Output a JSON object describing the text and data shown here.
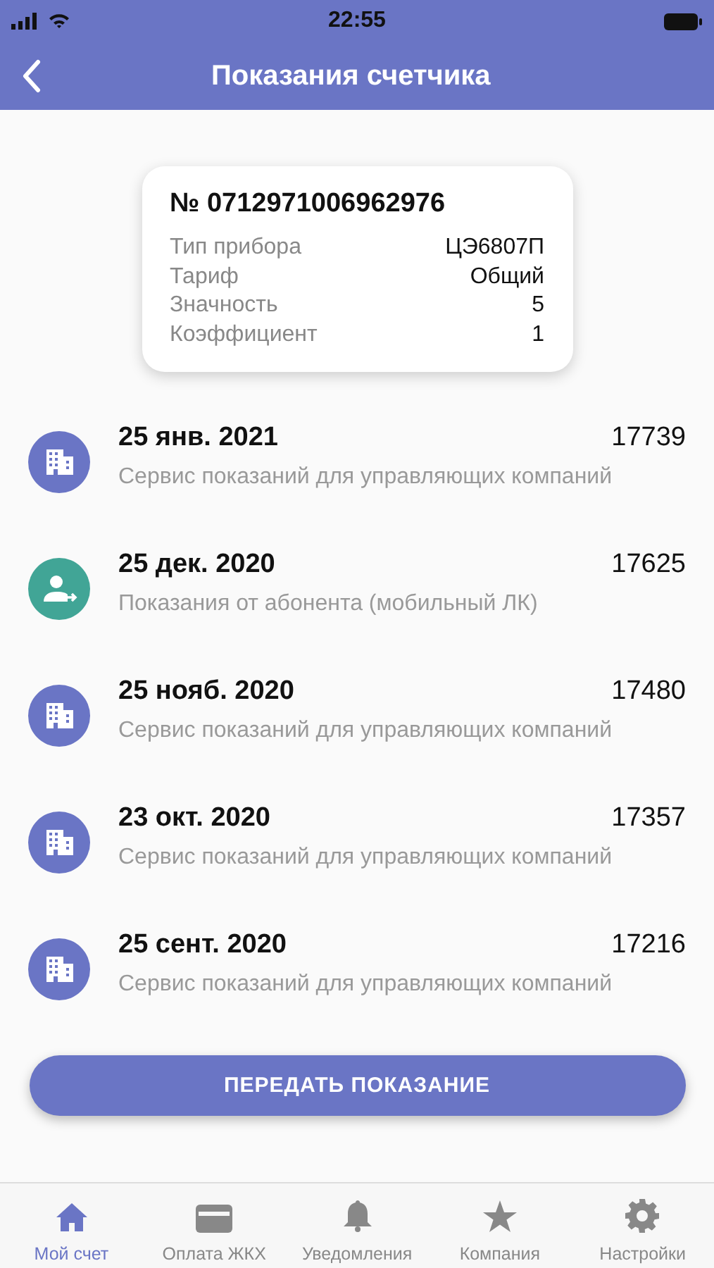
{
  "status_bar": {
    "time": "22:55"
  },
  "header": {
    "title": "Показания счетчика"
  },
  "meter": {
    "number": "№ 0712971006962976",
    "props": [
      {
        "label": "Тип прибора",
        "value": "ЦЭ6807П"
      },
      {
        "label": "Тариф",
        "value": "Общий"
      },
      {
        "label": "Значность",
        "value": "5"
      },
      {
        "label": "Коэффициент",
        "value": "1"
      }
    ]
  },
  "readings": [
    {
      "kind": "company",
      "date": "25 янв. 2021",
      "value": "17739",
      "source": "Сервис показаний для управляющих компаний"
    },
    {
      "kind": "subscriber",
      "date": "25 дек. 2020",
      "value": "17625",
      "source": "Показания от абонента (мобильный ЛК)"
    },
    {
      "kind": "company",
      "date": "25 нояб. 2020",
      "value": "17480",
      "source": "Сервис показаний для управляющих компаний"
    },
    {
      "kind": "company",
      "date": "23 окт. 2020",
      "value": "17357",
      "source": "Сервис показаний для управляющих компаний"
    },
    {
      "kind": "company",
      "date": "25 сент. 2020",
      "value": "17216",
      "source": "Сервис показаний для управляющих компаний"
    }
  ],
  "submit_button": "ПЕРЕДАТЬ ПОКАЗАНИЕ",
  "tabs": [
    {
      "kind": "home",
      "label": "Мой счет",
      "selected": true
    },
    {
      "kind": "card",
      "label": "Оплата ЖКХ",
      "selected": false
    },
    {
      "kind": "bell",
      "label": "Уведомления",
      "selected": false
    },
    {
      "kind": "star",
      "label": "Компания",
      "selected": false
    },
    {
      "kind": "gear",
      "label": "Настройки",
      "selected": false
    }
  ]
}
